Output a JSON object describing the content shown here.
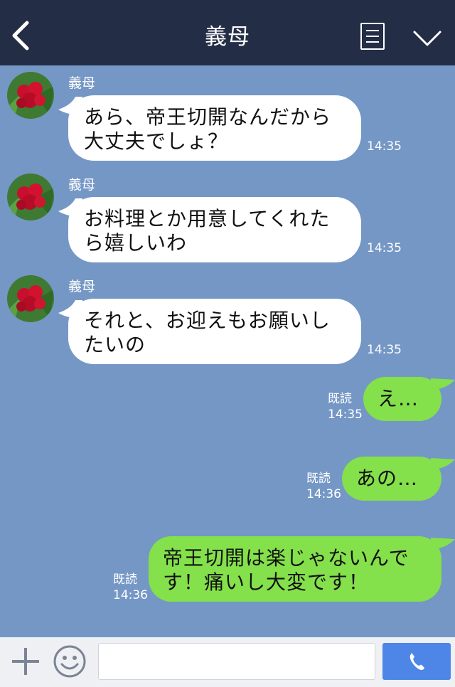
{
  "header": {
    "title": "義母",
    "back_icon": "chevron-left-icon",
    "menu_icon": "menu-lines-icon",
    "collapse_icon": "chevron-down-icon",
    "background_color": "#232d45"
  },
  "chat": {
    "background_color": "#7597c5",
    "incoming": [
      {
        "sender": "義母",
        "lines": [
          "あら、帝王切開なんだから",
          "大丈夫でしょ？"
        ],
        "time": "14:35"
      },
      {
        "sender": "義母",
        "lines": [
          "お料理とか用意してくれた",
          "ら嬉しいわ"
        ],
        "time": "14:35"
      },
      {
        "sender": "義母",
        "lines": [
          "それと、お迎えもお願いし",
          "たいの"
        ],
        "time": "14:35"
      }
    ],
    "outgoing": [
      {
        "lines": [
          "え…"
        ],
        "read": "既読",
        "time": "14:35"
      },
      {
        "lines": [
          "あの…"
        ],
        "read": "既読",
        "time": "14:36"
      },
      {
        "lines": [
          "帝王切開は楽じゃないんで",
          "す！痛いし大変です！"
        ],
        "read": "既読",
        "time": "14:36"
      }
    ],
    "incoming_bubble_color": "#ffffff",
    "outgoing_bubble_color": "#84e04b"
  },
  "composer": {
    "plus_icon": "plus-icon",
    "emoji_icon": "smiley-icon",
    "input_value": "",
    "call_icon": "phone-icon",
    "call_button_color": "#4d86e6"
  }
}
